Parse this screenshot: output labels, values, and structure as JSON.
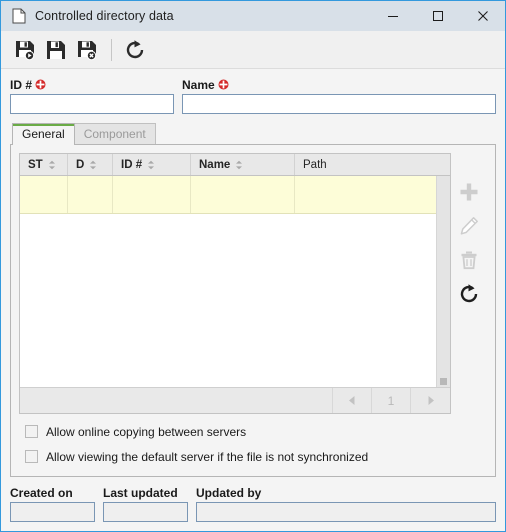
{
  "window": {
    "title": "Controlled directory data",
    "doc_icon": "document-icon",
    "controls": {
      "minimize": "minimize-icon",
      "maximize": "maximize-icon",
      "close": "close-icon"
    },
    "border_color": "#3399dd",
    "titlebar_color": "#d8e0e8"
  },
  "toolbar": {
    "buttons": [
      {
        "name": "save-and-new",
        "icon": "floppy-disk-play-icon",
        "enabled": true
      },
      {
        "name": "save",
        "icon": "floppy-disk-icon",
        "enabled": true
      },
      {
        "name": "save-and-close",
        "icon": "floppy-disk-cancel-icon",
        "enabled": true
      },
      {
        "name": "refresh",
        "icon": "refresh-icon",
        "enabled": true
      }
    ]
  },
  "form": {
    "id_label": "ID #",
    "id_value": "",
    "id_required": true,
    "name_label": "Name",
    "name_value": "",
    "name_required": true,
    "required_marker_color": "#d42a2a"
  },
  "tabs": {
    "active_accent": "#6aab46",
    "items": [
      {
        "label": "General",
        "active": true
      },
      {
        "label": "Component",
        "active": false
      }
    ]
  },
  "grid": {
    "columns": [
      {
        "label": "ST",
        "bold": true,
        "sortable": true,
        "width": 48
      },
      {
        "label": "D",
        "bold": true,
        "sortable": true,
        "width": 45
      },
      {
        "label": "ID #",
        "bold": true,
        "sortable": true,
        "width": 78
      },
      {
        "label": "Name",
        "bold": true,
        "sortable": true,
        "width": 104
      },
      {
        "label": "Path",
        "bold": false,
        "sortable": false,
        "width": 160
      }
    ],
    "rows": [
      {
        "ST": "",
        "D": "",
        "ID #": "",
        "Name": "",
        "Path": ""
      }
    ],
    "row_highlight_color": "#fdfdd8",
    "pager": {
      "prev_icon": "triangle-left-icon",
      "page": "1",
      "next_icon": "triangle-right-icon",
      "enabled": false
    }
  },
  "actions": [
    {
      "name": "add-row-button",
      "icon": "plus-icon",
      "enabled": false
    },
    {
      "name": "edit-row-button",
      "icon": "pencil-icon",
      "enabled": false
    },
    {
      "name": "delete-row-button",
      "icon": "trash-icon",
      "enabled": false
    },
    {
      "name": "refresh-grid-button",
      "icon": "refresh-icon",
      "enabled": true
    }
  ],
  "options": [
    {
      "label": "Allow online copying between servers",
      "checked": false
    },
    {
      "label": "Allow viewing the default server if the file is not synchronized",
      "checked": false
    }
  ],
  "footer": {
    "created_on_label": "Created on",
    "created_on_value": "",
    "last_updated_label": "Last updated",
    "last_updated_value": "",
    "updated_by_label": "Updated by",
    "updated_by_value": ""
  }
}
